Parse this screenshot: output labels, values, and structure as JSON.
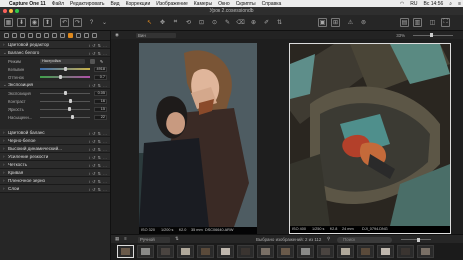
{
  "menubar": {
    "app": "Capture One 11",
    "items": [
      "Файл",
      "Редактировать",
      "Вид",
      "Коррекции",
      "Изображение",
      "Камеры",
      "Окно",
      "Скрипты",
      "Справка"
    ],
    "lang": "RU",
    "time": "Вс 14:56"
  },
  "window": {
    "title": "Урок 2.cosessiondb"
  },
  "left_panel": {
    "sections": [
      {
        "label": "Цветовой редактор",
        "expanded": false
      },
      {
        "label": "Баланс белого",
        "expanded": true
      },
      {
        "label": "Экспозиция",
        "expanded": true
      },
      {
        "label": "Цветовой баланс",
        "expanded": false
      },
      {
        "label": "Черно-белое",
        "expanded": false
      },
      {
        "label": "Высокий динамический...",
        "expanded": false
      },
      {
        "label": "Усиление резкости",
        "expanded": false
      },
      {
        "label": "Четкость",
        "expanded": false
      },
      {
        "label": "Кривая",
        "expanded": false
      },
      {
        "label": "Пленочное зерно",
        "expanded": false
      },
      {
        "label": "Слои",
        "expanded": false
      }
    ],
    "white_balance": {
      "mode_label": "Режим",
      "mode_value": "Настройка",
      "kelvin_label": "Кельвин",
      "kelvin_value": "4918",
      "tint_label": "Оттенок",
      "tint_value": "0.7"
    },
    "exposure": {
      "exposure_label": "Экспозиция",
      "exposure_value": "0.05",
      "contrast_label": "Контраст",
      "contrast_value": "16",
      "brightness_label": "Яркость",
      "brightness_value": "15",
      "saturation_label": "Насыщенн...",
      "saturation_value": "22"
    }
  },
  "viewer": {
    "variant_select": "Вин",
    "zoom": "33%",
    "left_image": {
      "iso": "ISO 320",
      "shutter": "1/200 s",
      "aperture": "f/2.0",
      "focal": "35 mm",
      "filename": "DSC06640.ARW"
    },
    "right_image": {
      "iso": "ISO 400",
      "shutter": "1/250 s",
      "aperture": "f/2.8",
      "focal": "24 mm",
      "filename": "DJI_0794.DNG"
    }
  },
  "filmstrip": {
    "album": "Ручной",
    "count": "Выбрано изображений: 2 из 112",
    "search_placeholder": "Поиск",
    "thumb_count": 16
  },
  "colors": {
    "accent": "#e08a1e",
    "panel": "#262626",
    "background": "#1c1c1c"
  }
}
